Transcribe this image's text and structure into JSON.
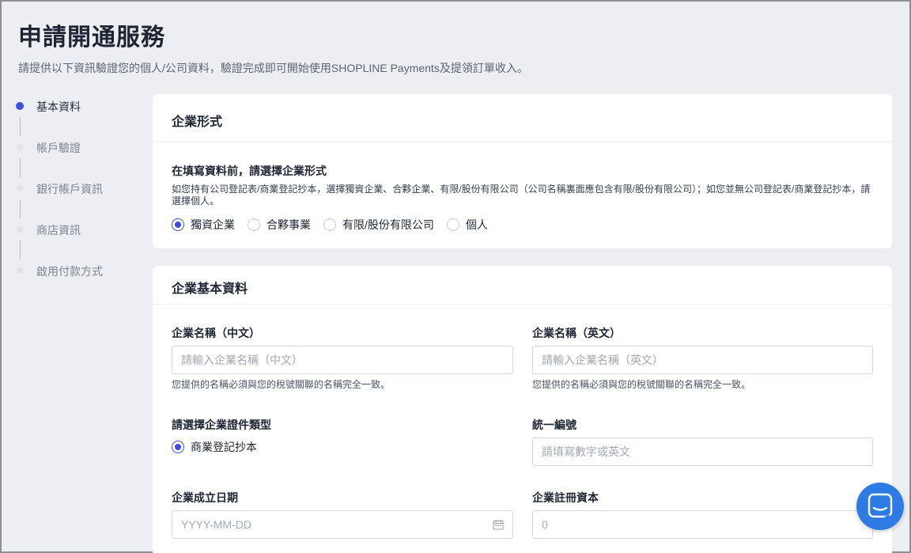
{
  "page": {
    "title": "申請開通服務",
    "subtitle": "請提供以下資訊驗證您的個人/公司資料，驗證完成即可開始使用SHOPLINE Payments及提領訂單收入。"
  },
  "stepper": {
    "steps": [
      {
        "label": "基本資料",
        "active": true
      },
      {
        "label": "帳戶驗證",
        "active": false
      },
      {
        "label": "銀行帳戶資訊",
        "active": false
      },
      {
        "label": "商店資訊",
        "active": false
      },
      {
        "label": "啟用付款方式",
        "active": false
      }
    ]
  },
  "entity_type": {
    "header": "企業形式",
    "question": "在填寫資料前，請選擇企業形式",
    "description": "如您持有公司登記表/商業登記抄本，選擇獨資企業、合夥企業、有限/股份有限公司（公司名稱裏面應包含有限/股份有限公司）；如您並無公司登記表/商業登記抄本，請選擇個人。",
    "options": [
      "獨資企業",
      "合夥事業",
      "有限/股份有限公司",
      "個人"
    ],
    "selected": "獨資企業"
  },
  "basic_info": {
    "header": "企業基本資料",
    "name_zh": {
      "label": "企業名稱（中文）",
      "placeholder": "請輸入企業名稱（中文）",
      "hint": "您提供的名稱必須與您的稅號關聯的名稱完全一致。"
    },
    "name_en": {
      "label": "企業名稱（英文）",
      "placeholder": "請輸入企業名稱（英文）",
      "hint": "您提供的名稱必須與您的稅號關聯的名稱完全一致。"
    },
    "doc_type": {
      "label": "請選擇企業證件類型",
      "option": "商業登記抄本"
    },
    "tax_id": {
      "label": "統一編號",
      "placeholder": "請填寫數字或英文"
    },
    "founded": {
      "label": "企業成立日期",
      "placeholder": "YYYY-MM-DD"
    },
    "capital": {
      "label": "企業註冊資本",
      "placeholder": "0"
    }
  },
  "colors": {
    "accent": "#3e4fe0",
    "chat": "#2f7be4",
    "background": "#eceef2"
  }
}
